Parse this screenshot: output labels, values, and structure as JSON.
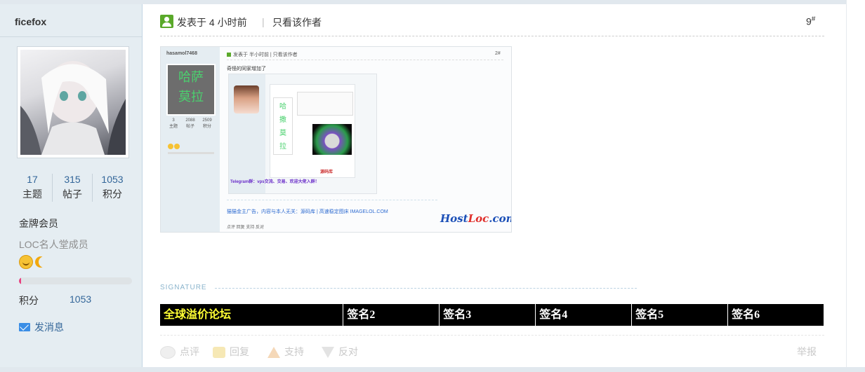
{
  "user": {
    "name": "ficefox",
    "stats": [
      {
        "value": "17",
        "label": "主题"
      },
      {
        "value": "315",
        "label": "帖子"
      },
      {
        "value": "1053",
        "label": "积分"
      }
    ],
    "rank": "金牌会员",
    "custom_title": "LOC名人堂成员",
    "medal_icons": [
      "smiley-medal-icon",
      "moon-medal-icon"
    ],
    "progress_fraction": 0.02,
    "credits_label": "积分",
    "credits_value": "1053",
    "message_label": "发消息"
  },
  "post": {
    "posted_time": "发表于 4 小时前",
    "separator": "|",
    "author_only": "只看该作者",
    "floor": "9",
    "floor_mark": "#"
  },
  "embedded_screenshot": {
    "username": "hasamol7468",
    "avatar_text": [
      "哈萨",
      "莫拉"
    ],
    "stats": [
      "3",
      "2088",
      "2509"
    ],
    "stat_labels": [
      "主题",
      "帖子",
      "积分"
    ],
    "header": "发表于 半小时前 | 只看该作者",
    "floor": "2#",
    "text": "奇怪的同家增加了",
    "inner_avatar_text": [
      "哈",
      "撒",
      "莫",
      "拉"
    ],
    "telegram_line": "Telegram群：vps交流、交易、欢迎大佬入群！",
    "highlight": "源码库",
    "ad_line": "猫猫金主广告，内容与本人无关：源码库 | 高速稳定图床 IMAGELOL.COM",
    "actions": "点评  回复  支持  反对",
    "brand_a": "Host",
    "brand_b": "Loc",
    "brand_c": ".com"
  },
  "signature": {
    "label": "SIGNATURE",
    "items": [
      "全球溢价论坛",
      "签名2",
      "签名3",
      "签名4",
      "签名5",
      "签名6"
    ],
    "first_item_color": "#ffff33"
  },
  "actions": {
    "comment": "点评",
    "reply": "回复",
    "support": "支持",
    "oppose": "反对",
    "report": "举报"
  },
  "colors": {
    "sidebar_bg": "#e5edf2",
    "link": "#336699",
    "progress": "#e84080",
    "signature_bar": "#000000"
  }
}
